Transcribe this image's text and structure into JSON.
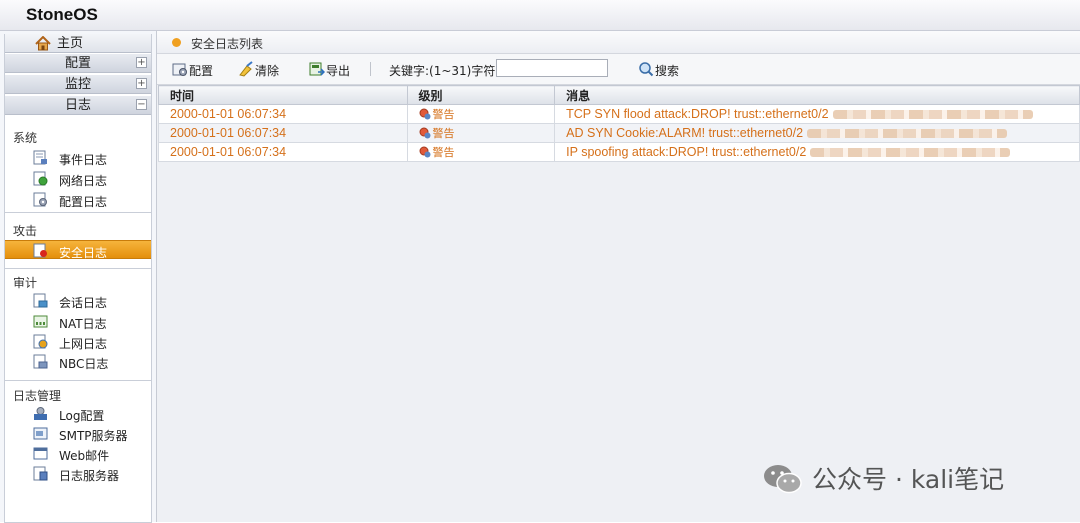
{
  "app": {
    "brand": "StoneOS"
  },
  "sidebar": {
    "home": "主页",
    "menus": [
      {
        "label": "配置",
        "toggle": "+"
      },
      {
        "label": "监控",
        "toggle": "+"
      },
      {
        "label": "日志",
        "toggle": "−"
      }
    ],
    "groups": [
      {
        "title": "系统",
        "items": [
          {
            "label": "事件日志",
            "icon": "event-log-icon"
          },
          {
            "label": "网络日志",
            "icon": "network-log-icon"
          },
          {
            "label": "配置日志",
            "icon": "config-log-icon"
          }
        ]
      },
      {
        "title": "攻击",
        "items": [
          {
            "label": "安全日志",
            "icon": "security-log-icon",
            "active": true
          }
        ]
      },
      {
        "title": "审计",
        "items": [
          {
            "label": "会话日志",
            "icon": "session-log-icon"
          },
          {
            "label": "NAT日志",
            "icon": "nat-log-icon"
          },
          {
            "label": "上网日志",
            "icon": "web-access-log-icon"
          },
          {
            "label": "NBC日志",
            "icon": "nbc-log-icon"
          }
        ]
      },
      {
        "title": "日志管理",
        "items": [
          {
            "label": "Log配置",
            "icon": "log-config-icon"
          },
          {
            "label": "SMTP服务器",
            "icon": "smtp-server-icon"
          },
          {
            "label": "Web邮件",
            "icon": "web-mail-icon"
          },
          {
            "label": "日志服务器",
            "icon": "log-server-icon"
          }
        ]
      }
    ]
  },
  "panel": {
    "title": "安全日志列表"
  },
  "toolbar": {
    "config": "配置",
    "clear": "清除",
    "export": "导出",
    "keyword_label": "关键字:(1~31)字符",
    "keyword_value": "",
    "search": "搜索"
  },
  "table": {
    "columns": [
      "时间",
      "级别",
      "消息"
    ],
    "rows": [
      {
        "time": "2000-01-01 06:07:34",
        "level": "警告",
        "message": "TCP SYN flood attack:DROP! trust::ethernet0/2"
      },
      {
        "time": "2000-01-01 06:07:34",
        "level": "警告",
        "message": "AD SYN Cookie:ALARM! trust::ethernet0/2"
      },
      {
        "time": "2000-01-01 06:07:34",
        "level": "警告",
        "message": "IP spoofing attack:DROP! trust::ethernet0/2"
      }
    ]
  },
  "watermark": {
    "text": "公众号 · kali笔记"
  },
  "colors": {
    "accent": "#f0a020",
    "active": "#e48f0c",
    "log_text": "#d5701a"
  }
}
